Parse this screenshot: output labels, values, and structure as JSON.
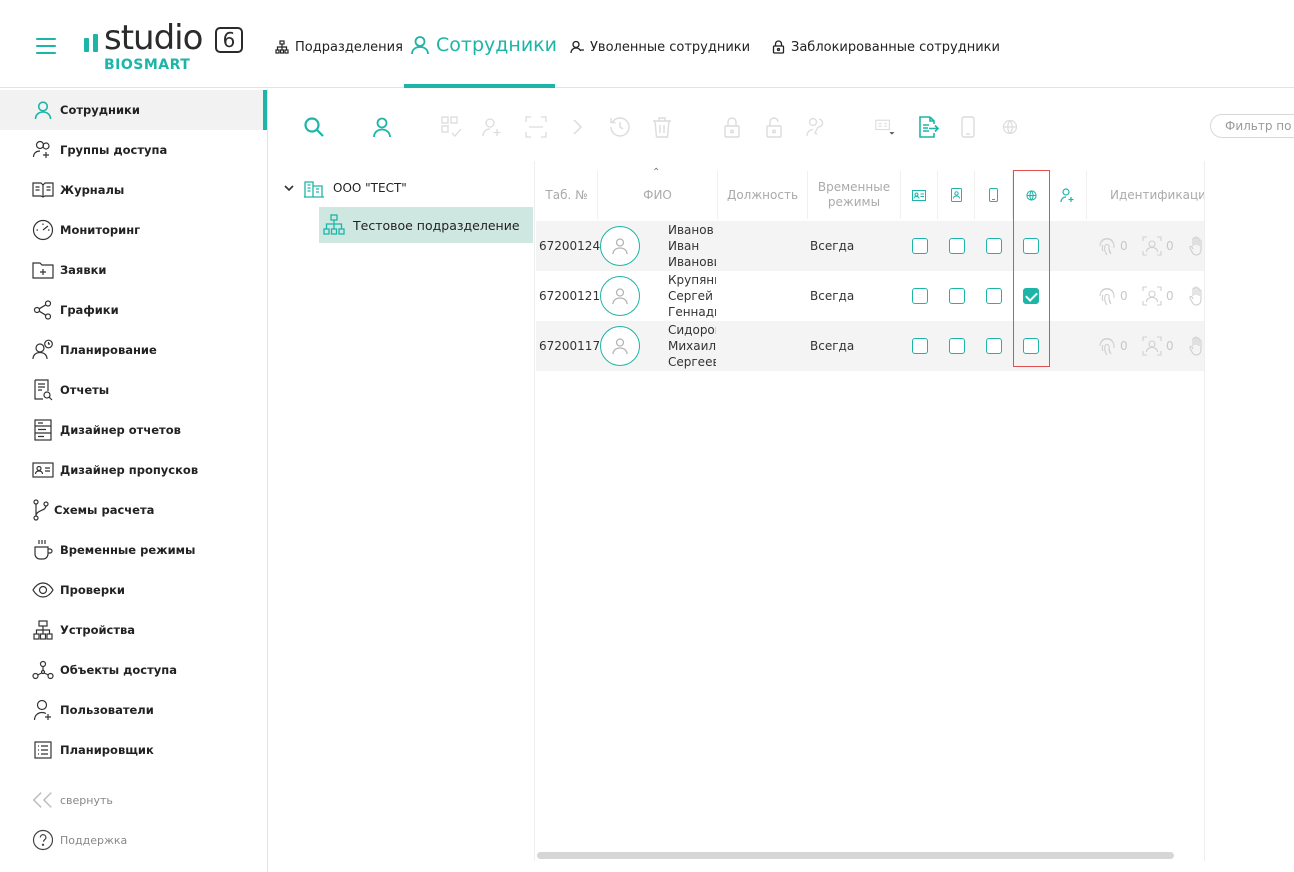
{
  "header": {
    "logo_word": "studio",
    "logo_version": "6",
    "logo_sub": "BIOSMART",
    "tabs": [
      {
        "label": "Подразделения",
        "icon": "org-structure-icon"
      },
      {
        "label": "Сотрудники",
        "icon": "user-icon",
        "active": true
      },
      {
        "label": "Уволенные сотрудники",
        "icon": "user-minus-icon"
      },
      {
        "label": "Заблокированные сотрудники",
        "icon": "lock-icon"
      }
    ]
  },
  "sidebar": {
    "items": [
      {
        "label": "Сотрудники",
        "icon": "user-icon",
        "active": true
      },
      {
        "label": "Группы доступа",
        "icon": "users-group-icon"
      },
      {
        "label": "Журналы",
        "icon": "book-icon"
      },
      {
        "label": "Мониторинг",
        "icon": "gauge-icon"
      },
      {
        "label": "Заявки",
        "icon": "folder-plus-icon"
      },
      {
        "label": "Графики",
        "icon": "share-icon"
      },
      {
        "label": "Планирование",
        "icon": "user-clock-icon"
      },
      {
        "label": "Отчеты",
        "icon": "report-search-icon"
      },
      {
        "label": "Дизайнер отчетов",
        "icon": "report-designer-icon"
      },
      {
        "label": "Дизайнер пропусков",
        "icon": "id-card-icon"
      },
      {
        "label": "Схемы расчета",
        "icon": "branch-icon"
      },
      {
        "label": "Временные режимы",
        "icon": "coffee-cup-icon"
      },
      {
        "label": "Проверки",
        "icon": "eye-icon"
      },
      {
        "label": "Устройства",
        "icon": "devices-icon"
      },
      {
        "label": "Объекты доступа",
        "icon": "nodes-icon"
      },
      {
        "label": "Пользователи",
        "icon": "user-plus-icon"
      },
      {
        "label": "Планировщик",
        "icon": "list-icon"
      }
    ],
    "collapse_label": "свернуть",
    "support_label": "Поддержка"
  },
  "toolbar": {
    "filter_placeholder": "Фильтр по"
  },
  "tree": {
    "root_label": "ООО \"ТЕСТ\"",
    "child_label": "Тестовое подразделение"
  },
  "grid": {
    "columns": {
      "tab_no": "Таб. №",
      "fio": "ФИО",
      "position": "Должность",
      "time_modes": "Временные режимы",
      "identification": "Идентификаци"
    },
    "rows": [
      {
        "tab_no": "67200124",
        "fio_lines": [
          "Иванов",
          "Иван",
          "Иванович"
        ],
        "time_mode": "Всегда",
        "checks": [
          false,
          false,
          false,
          false
        ],
        "ident": [
          "0",
          "0"
        ]
      },
      {
        "tab_no": "67200121",
        "fio_lines": [
          "Крупянко",
          "Сергей",
          "Геннадьевич"
        ],
        "time_mode": "Всегда",
        "checks": [
          false,
          false,
          false,
          true
        ],
        "ident": [
          "0",
          "0"
        ]
      },
      {
        "tab_no": "67200117",
        "fio_lines": [
          "Сидоров",
          "Михаил",
          "Сергеевич"
        ],
        "time_mode": "Всегда",
        "checks": [
          false,
          false,
          false,
          false
        ],
        "ident": [
          "0",
          "0"
        ]
      }
    ]
  },
  "colors": {
    "accent": "#1cb5a7",
    "selected_tree": "#cfe7e1",
    "highlight": "#e05050"
  }
}
